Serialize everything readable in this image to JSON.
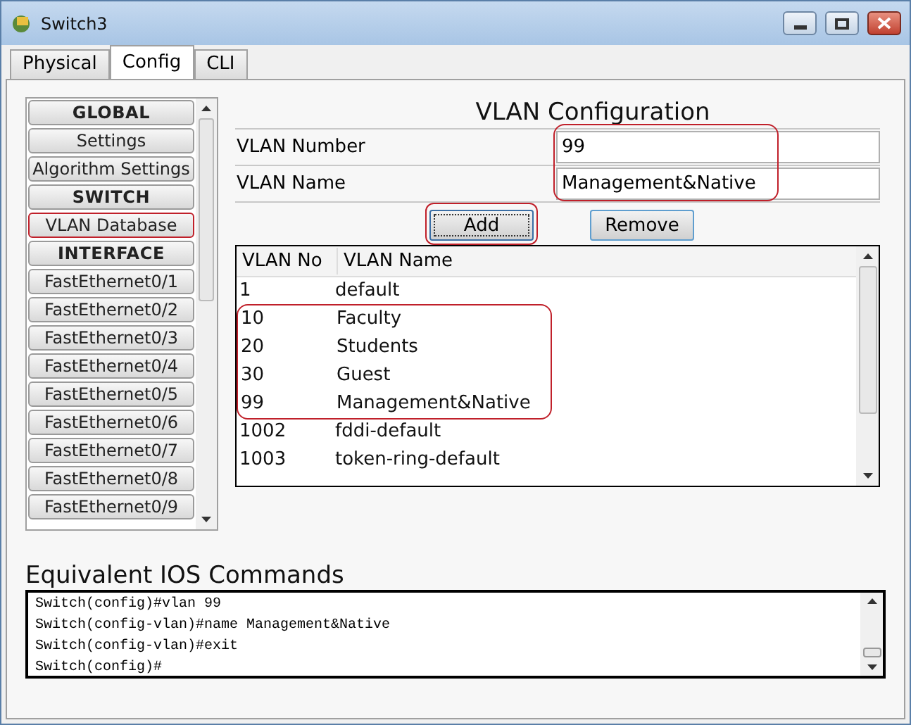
{
  "window": {
    "title": "Switch3"
  },
  "tabs": [
    {
      "label": "Physical",
      "selected": false
    },
    {
      "label": "Config",
      "selected": true
    },
    {
      "label": "CLI",
      "selected": false
    }
  ],
  "sidebar": {
    "items": [
      {
        "label": "GLOBAL",
        "kind": "header",
        "highlighted": false
      },
      {
        "label": "Settings",
        "kind": "item",
        "highlighted": false
      },
      {
        "label": "Algorithm Settings",
        "kind": "item",
        "highlighted": false
      },
      {
        "label": "SWITCH",
        "kind": "header",
        "highlighted": false
      },
      {
        "label": "VLAN Database",
        "kind": "item",
        "highlighted": true
      },
      {
        "label": "INTERFACE",
        "kind": "header",
        "highlighted": false
      },
      {
        "label": "FastEthernet0/1",
        "kind": "item",
        "highlighted": false
      },
      {
        "label": "FastEthernet0/2",
        "kind": "item",
        "highlighted": false
      },
      {
        "label": "FastEthernet0/3",
        "kind": "item",
        "highlighted": false
      },
      {
        "label": "FastEthernet0/4",
        "kind": "item",
        "highlighted": false
      },
      {
        "label": "FastEthernet0/5",
        "kind": "item",
        "highlighted": false
      },
      {
        "label": "FastEthernet0/6",
        "kind": "item",
        "highlighted": false
      },
      {
        "label": "FastEthernet0/7",
        "kind": "item",
        "highlighted": false
      },
      {
        "label": "FastEthernet0/8",
        "kind": "item",
        "highlighted": false
      },
      {
        "label": "FastEthernet0/9",
        "kind": "item",
        "highlighted": false
      }
    ]
  },
  "vlan_config": {
    "title": "VLAN Configuration",
    "fields_highlighted": true,
    "fields": [
      {
        "label": "VLAN Number",
        "value": "99"
      },
      {
        "label": "VLAN Name",
        "value": "Management&Native"
      }
    ],
    "buttons": [
      {
        "label": "Add",
        "highlighted": true
      },
      {
        "label": "Remove",
        "highlighted": false
      }
    ],
    "table": {
      "columns": [
        "VLAN No",
        "VLAN Name"
      ],
      "rows": [
        {
          "cells": [
            "1",
            "default"
          ],
          "highlighted": false
        },
        {
          "cells": [
            "10",
            "Faculty"
          ],
          "highlighted": true
        },
        {
          "cells": [
            "20",
            "Students"
          ],
          "highlighted": true
        },
        {
          "cells": [
            "30",
            "Guest"
          ],
          "highlighted": true
        },
        {
          "cells": [
            "99",
            "Management&Native"
          ],
          "highlighted": true
        },
        {
          "cells": [
            "1002",
            "fddi-default"
          ],
          "highlighted": false
        },
        {
          "cells": [
            "1003",
            "token-ring-default"
          ],
          "highlighted": false
        }
      ]
    }
  },
  "ios_commands": {
    "title": "Equivalent IOS Commands",
    "lines": [
      "Switch(config)#vlan 99",
      "Switch(config-vlan)#name Management&Native",
      "Switch(config-vlan)#exit",
      "Switch(config)#"
    ]
  }
}
